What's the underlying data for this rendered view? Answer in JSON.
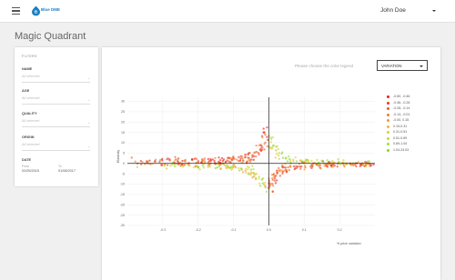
{
  "topbar": {
    "brand": "Blue DME",
    "user_name": "John Doe"
  },
  "page": {
    "title": "Magic Quadrant"
  },
  "filters": {
    "header": "FILTERS",
    "groups": [
      {
        "label": "NAME",
        "placeholder": "All selected"
      },
      {
        "label": "AGE",
        "placeholder": "All selected"
      },
      {
        "label": "QUALITY",
        "placeholder": "All selected"
      },
      {
        "label": "ORIGIN",
        "placeholder": "All selected"
      }
    ],
    "date": {
      "label": "DATE",
      "from_label": "From",
      "from_value": "02/05/2015",
      "to_label": "To",
      "to_value": "01/08/2017"
    }
  },
  "chart_controls": {
    "prompt": "Please choose the color legend",
    "selected": "VARIATION"
  },
  "chart_data": {
    "type": "scatter",
    "title": "",
    "xlabel": "% price variation",
    "ylabel": "Elasticity",
    "xlim": [
      -0.4,
      0.3
    ],
    "ylim": [
      -30,
      32
    ],
    "x_ticks": [
      -0.3,
      -0.2,
      -0.1,
      0.0,
      0.1,
      0.2
    ],
    "x_tick_labels": [
      "-0.3",
      "-0.2",
      "-0.1",
      "0.0",
      "0.1",
      "0.2"
    ],
    "y_ticks": [
      30,
      25,
      20,
      15,
      10,
      5,
      0,
      -5,
      -10,
      -15,
      -20,
      -25,
      -30
    ],
    "y_tick_labels": [
      "30",
      "25",
      "20",
      "15",
      "10",
      "5",
      "0",
      "-5",
      "-10",
      "-15",
      "-20",
      "-25",
      "-30"
    ],
    "grid": true,
    "legend_position": "right",
    "series": [
      {
        "name": "-0.60, -0.46",
        "color": "#e8201e"
      },
      {
        "name": "-0.46, -0.28",
        "color": "#ea3a1f"
      },
      {
        "name": "-0.28, -0.14",
        "color": "#ee5a22"
      },
      {
        "name": "-0.14, -0.01",
        "color": "#f17b25"
      },
      {
        "name": "-0.00, 0.15",
        "color": "#f39a27"
      },
      {
        "name": "0.15-0.31",
        "color": "#f3b82a"
      },
      {
        "name": "0.31-0.51",
        "color": "#e4cc2d"
      },
      {
        "name": "0.51-0.69",
        "color": "#c6d930"
      },
      {
        "name": "0.69-1.04",
        "color": "#9ee033"
      },
      {
        "name": "1.04-24.03",
        "color": "#7ad936"
      }
    ]
  }
}
